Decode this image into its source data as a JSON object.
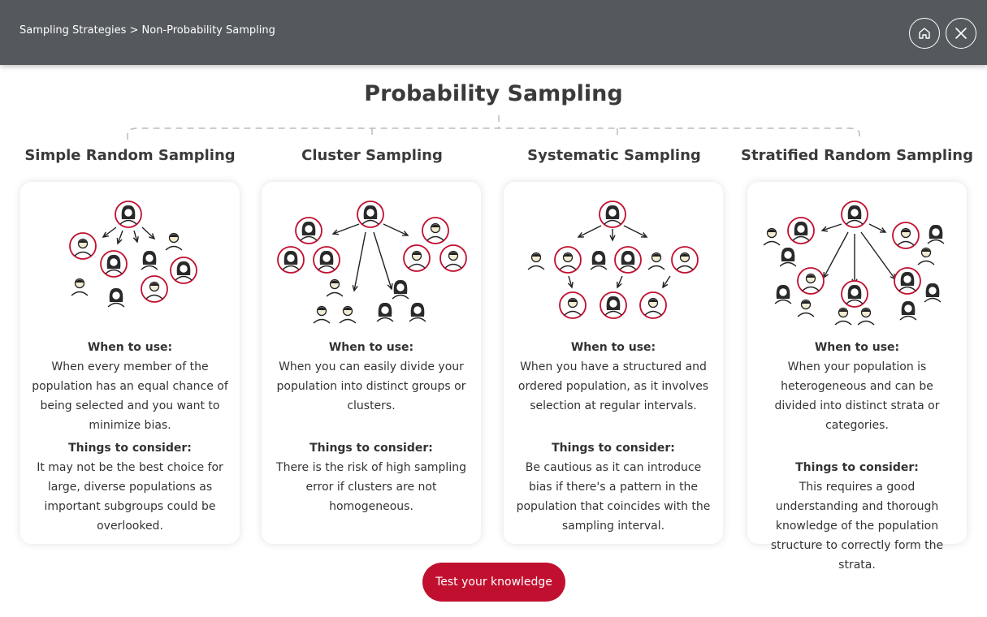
{
  "header": {
    "breadcrumb": "Sampling Strategies > Non-Probability Sampling",
    "home_icon": "home-icon",
    "close_icon": "close-icon"
  },
  "page": {
    "title": "Probability Sampling"
  },
  "colors": {
    "header_bg": "#55595e",
    "accent": "#c1102f",
    "text": "#333333"
  },
  "columns": [
    {
      "title": "Simple Random Sampling",
      "when_label": "When to use:",
      "when_text": "When every member of the population has an equal chance of being selected and you want to minimize bias.",
      "consider_label": "Things to consider:",
      "consider_text": "It may not be the best choice for large, diverse populations as important subgroups could be overlooked."
    },
    {
      "title": "Cluster Sampling",
      "when_label": "When to use:",
      "when_text": "When you can easily divide your population into distinct groups or clusters.",
      "consider_label": "Things to consider:",
      "consider_text": "There is the risk of high sampling error if clusters are not homogeneous."
    },
    {
      "title": "Systematic Sampling",
      "when_label": "When to use:",
      "when_text": "When you have a structured and ordered population, as it involves selection at regular intervals.",
      "consider_label": "Things to consider:",
      "consider_text": "Be cautious as it can introduce bias if there's a pattern in the population that coincides with the sampling interval."
    },
    {
      "title": "Stratified Random Sampling",
      "when_label": "When to use:",
      "when_text": "When your population is heterogeneous and can be divided into distinct strata or categories.",
      "consider_label": "Things to consider:",
      "consider_text": "This requires a good understanding and thorough knowledge of the population structure to correctly form the strata."
    }
  ],
  "cta": {
    "label": "Test your knowledge"
  }
}
